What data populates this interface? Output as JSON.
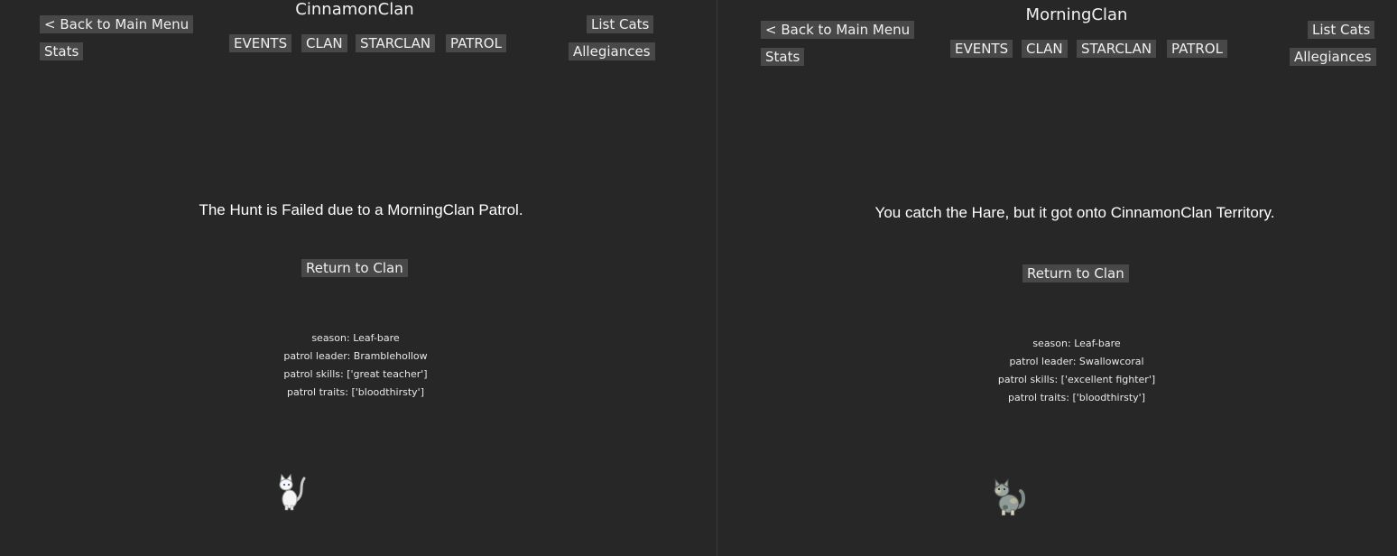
{
  "screens": [
    {
      "clan_name": "CinnamonClan",
      "nav": {
        "back_label": "< Back to Main Menu",
        "stats_label": "Stats",
        "list_cats_label": "List Cats",
        "allegiances_label": "Allegiances"
      },
      "tabs": [
        "EVENTS",
        "CLAN",
        "STARCLAN",
        "PATROL"
      ],
      "result_text": "The Hunt is Failed due to a MorningClan Patrol.",
      "return_label": "Return to Clan",
      "info": {
        "season": "season: Leaf-bare",
        "leader": "patrol leader: Bramblehollow",
        "skills": "patrol skills: ['great teacher']",
        "traits": "patrol traits: ['bloodthirsty']"
      },
      "cat_icon": "white-cat-sprite"
    },
    {
      "clan_name": "MorningClan",
      "nav": {
        "back_label": "< Back to Main Menu",
        "stats_label": "Stats",
        "list_cats_label": "List Cats",
        "allegiances_label": "Allegiances"
      },
      "tabs": [
        "EVENTS",
        "CLAN",
        "STARCLAN",
        "PATROL"
      ],
      "result_text": "You catch the Hare, but it got onto CinnamonClan Territory.",
      "return_label": "Return to Clan",
      "info": {
        "season": "season: Leaf-bare",
        "leader": "patrol leader: Swallowcoral",
        "skills": "patrol skills: ['excellent fighter']",
        "traits": "patrol traits: ['bloodthirsty']"
      },
      "cat_icon": "grey-tortie-cat-sprite"
    }
  ]
}
